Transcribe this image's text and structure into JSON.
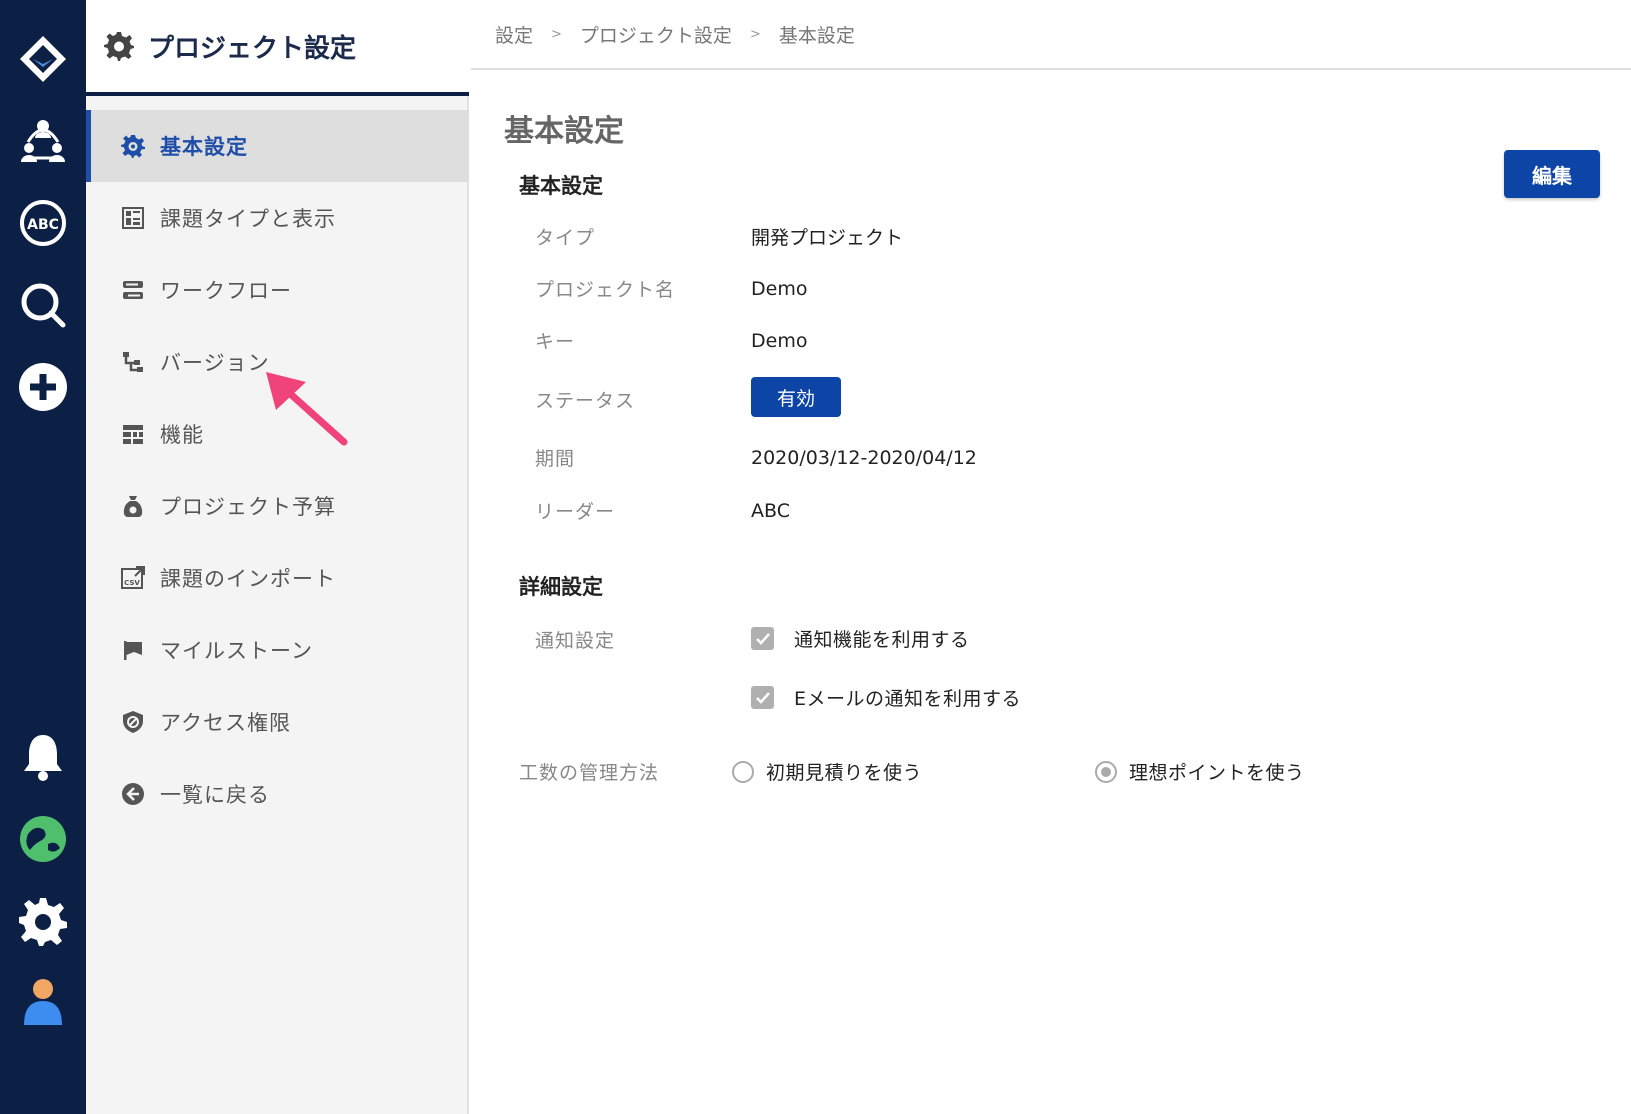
{
  "sidebar": {
    "title": "プロジェクト設定",
    "items": [
      {
        "label": "基本設定",
        "icon": "gear-icon",
        "active": true
      },
      {
        "label": "課題タイプと表示",
        "icon": "issue-type-icon",
        "active": false
      },
      {
        "label": "ワークフロー",
        "icon": "workflow-icon",
        "active": false
      },
      {
        "label": "バージョン",
        "icon": "version-icon",
        "active": false
      },
      {
        "label": "機能",
        "icon": "features-icon",
        "active": false
      },
      {
        "label": "プロジェクト予算",
        "icon": "budget-icon",
        "active": false
      },
      {
        "label": "課題のインポート",
        "icon": "csv-import-icon",
        "active": false
      },
      {
        "label": "マイルストーン",
        "icon": "flag-icon",
        "active": false
      },
      {
        "label": "アクセス権限",
        "icon": "shield-icon",
        "active": false
      },
      {
        "label": "一覧に戻る",
        "icon": "back-arrow-icon",
        "active": false
      }
    ]
  },
  "breadcrumb": [
    "設定",
    "プロジェクト設定",
    "基本設定"
  ],
  "breadcrumb_separator": ">",
  "main": {
    "page_title": "基本設定",
    "edit_label": "編集",
    "basic": {
      "section_title": "基本設定",
      "type_label": "タイプ",
      "type_value": "開発プロジェクト",
      "name_label": "プロジェクト名",
      "name_value": "Demo",
      "key_label": "キー",
      "key_value": "Demo",
      "status_label": "ステータス",
      "status_value": "有効",
      "period_label": "期間",
      "period_value": "2020/03/12-2020/04/12",
      "leader_label": "リーダー",
      "leader_value": "ABC"
    },
    "detail": {
      "section_title": "詳細設定",
      "notify_label": "通知設定",
      "notify_option1": "通知機能を利用する",
      "notify_option1_checked": true,
      "notify_option2": "Eメールの通知を利用する",
      "notify_option2_checked": true,
      "effort_label": "工数の管理方法",
      "effort_option1": "初期見積りを使う",
      "effort_option2": "理想ポイントを使う",
      "effort_selected": "理想ポイントを使う"
    }
  },
  "colors": {
    "rail_bg": "#0c1f45",
    "accent": "#1f4ea8",
    "button_bg": "#0c45a6",
    "arrow": "#f0437a"
  }
}
